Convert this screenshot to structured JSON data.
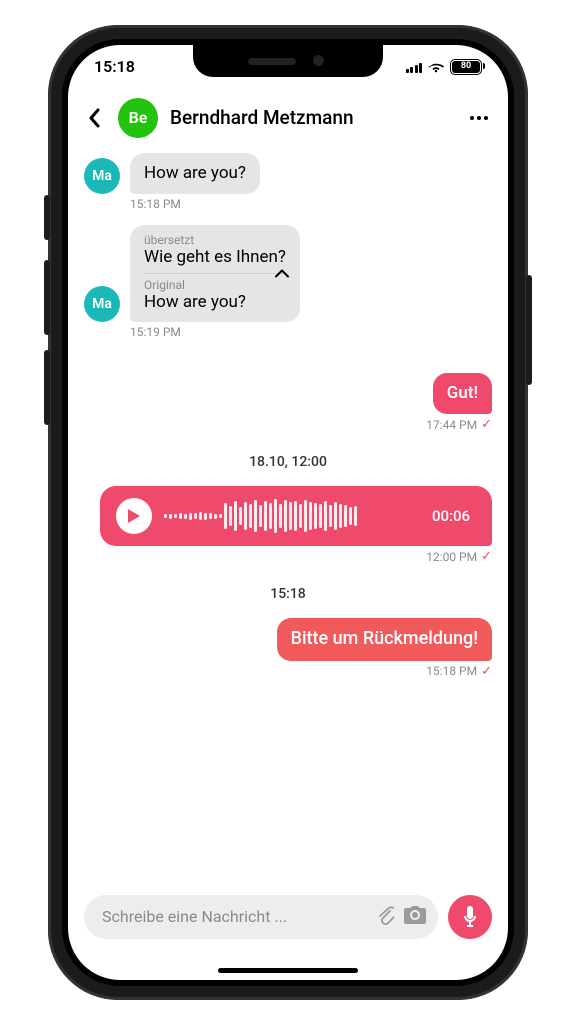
{
  "status": {
    "time": "15:18",
    "battery": "80"
  },
  "header": {
    "avatar_initials": "Be",
    "title": "Berndhard Metzmann"
  },
  "incoming_avatar": "Ma",
  "messages": {
    "m1": {
      "text": "How are you?",
      "time": "15:18 PM"
    },
    "m2": {
      "translated_label": "übersetzt",
      "translated_text": "Wie geht es Ihnen?",
      "original_label": "Original",
      "original_text": "How are you?",
      "time": "15:19 PM"
    },
    "m3": {
      "text": "Gut!",
      "time": "17:44 PM"
    },
    "sep1": "18.10, 12:00",
    "voice": {
      "duration": "00:06",
      "time": "12:00 PM"
    },
    "sep2": "15:18",
    "m4": {
      "text": "Bitte um Rückmeldung!",
      "time": "15:18 PM"
    }
  },
  "input": {
    "placeholder": "Schreibe eine Nachricht ..."
  }
}
